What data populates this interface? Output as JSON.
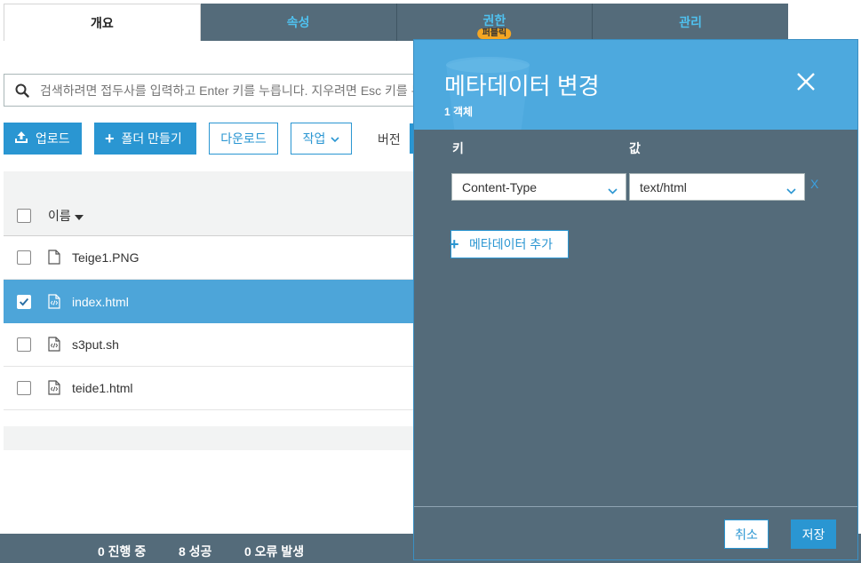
{
  "tabs": [
    {
      "label": "개요",
      "active": true
    },
    {
      "label": "속성",
      "active": false
    },
    {
      "label": "권한",
      "active": false,
      "badge": "퍼블릭"
    },
    {
      "label": "관리",
      "active": false
    }
  ],
  "search": {
    "placeholder": "검색하려면 접두사를 입력하고 Enter 키를 누릅니다. 지우려면 Esc 키를 누릅니다."
  },
  "toolbar": {
    "upload_label": "업로드",
    "create_folder_label": "폴더 만들기",
    "download_label": "다운로드",
    "actions_label": "작업",
    "versions_label": "버전"
  },
  "table": {
    "name_header": "이름",
    "rows": [
      {
        "name": "Teige1.PNG",
        "icon": "file-icon",
        "selected": false
      },
      {
        "name": "index.html",
        "icon": "code-file-icon",
        "selected": true
      },
      {
        "name": "s3put.sh",
        "icon": "code-file-icon",
        "selected": false
      },
      {
        "name": "teide1.html",
        "icon": "code-file-icon",
        "selected": false
      }
    ]
  },
  "status": {
    "in_progress": "0 진행 중",
    "succeeded": "8 성공",
    "errors": "0 오류 발생"
  },
  "modal": {
    "title": "메타데이터 변경",
    "subtitle": "1 객체",
    "key_label": "키",
    "value_label": "값",
    "key_value": "Content-Type",
    "value_value": "text/html",
    "remove_label": "X",
    "add_label": "메타데이터 추가",
    "cancel_label": "취소",
    "save_label": "저장"
  },
  "colors": {
    "accent": "#2a96d2",
    "header_bar": "#546b7a",
    "modal_header": "#4da9de",
    "selected_row": "#4da5d9",
    "badge": "#f5a623"
  }
}
